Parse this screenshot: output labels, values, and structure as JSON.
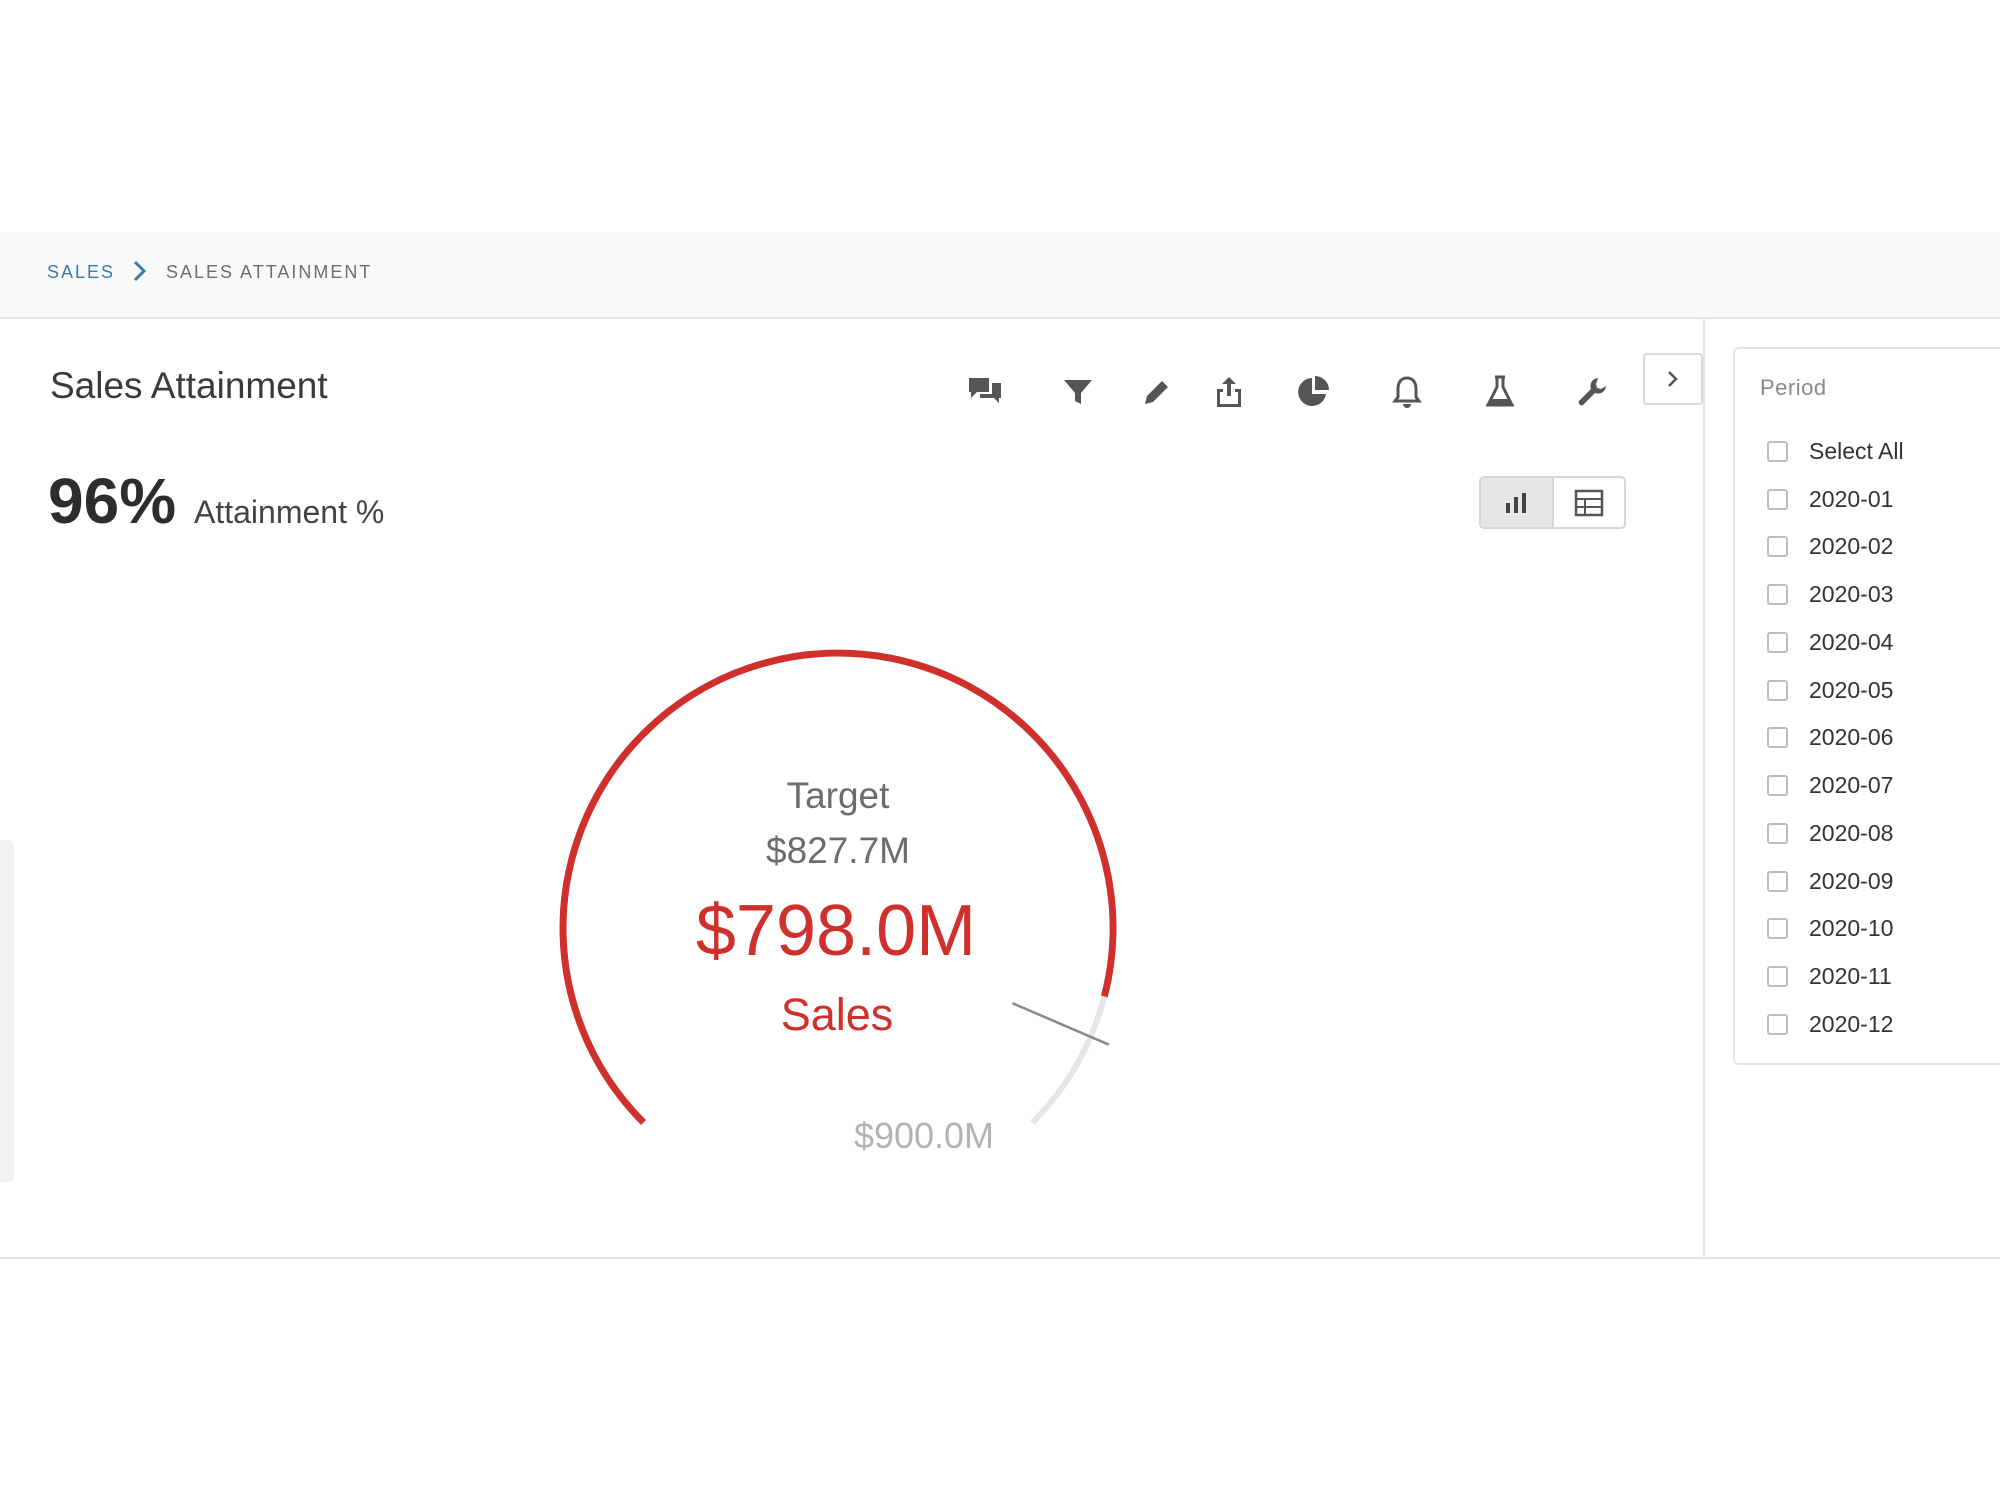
{
  "breadcrumb": {
    "items": [
      {
        "label": "SALES"
      },
      {
        "label": "SALES ATTAINMENT"
      }
    ]
  },
  "page": {
    "title": "Sales Attainment",
    "kpi": {
      "value": "96%",
      "label": "Attainment %"
    }
  },
  "toolbar": {
    "icons": [
      "comments-icon",
      "filter-icon",
      "pencil-icon",
      "share-icon",
      "pie-chart-icon",
      "bell-icon",
      "flask-icon",
      "wrench-icon"
    ]
  },
  "view_toggle": {
    "options": [
      "chart-view-icon",
      "table-view-icon"
    ],
    "selected": "chart-view-icon"
  },
  "chart_data": {
    "type": "gauge",
    "target_label": "Target",
    "target_value": "$827.7M",
    "value_text": "$798.0M",
    "value_label": "Sales",
    "max_text": "$900.0M",
    "min": 0,
    "max": 900.0,
    "value": 798.0,
    "target": 827.7,
    "unit": "$M",
    "colors": {
      "value": "#d0302c",
      "track": "#e6e6e6",
      "target_marker": "#888888"
    }
  },
  "filter_panel": {
    "title": "Period",
    "items": [
      {
        "label": "Select All",
        "checked": false
      },
      {
        "label": "2020-01",
        "checked": false
      },
      {
        "label": "2020-02",
        "checked": false
      },
      {
        "label": "2020-03",
        "checked": false
      },
      {
        "label": "2020-04",
        "checked": false
      },
      {
        "label": "2020-05",
        "checked": false
      },
      {
        "label": "2020-06",
        "checked": false
      },
      {
        "label": "2020-07",
        "checked": false
      },
      {
        "label": "2020-08",
        "checked": false
      },
      {
        "label": "2020-09",
        "checked": false
      },
      {
        "label": "2020-10",
        "checked": false
      },
      {
        "label": "2020-11",
        "checked": false
      },
      {
        "label": "2020-12",
        "checked": false
      }
    ]
  }
}
